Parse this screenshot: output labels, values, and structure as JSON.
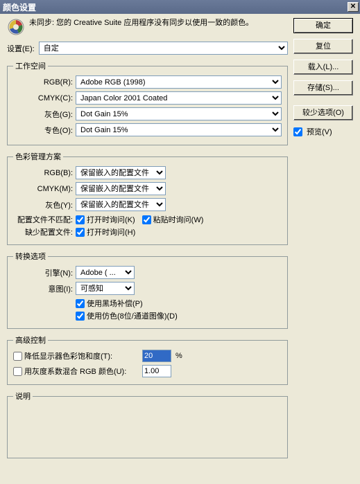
{
  "title": "颜色设置",
  "close_glyph": "✕",
  "sync": {
    "text": "未同步: 您的 Creative Suite 应用程序没有同步以使用一致的颜色。"
  },
  "buttons": {
    "ok": "确定",
    "reset": "复位",
    "load": "载入(L)...",
    "save": "存储(S)...",
    "fewer": "较少选项(O)"
  },
  "preview": {
    "label": "预览(V)"
  },
  "settings": {
    "label": "设置(E):",
    "value": "自定"
  },
  "workspace": {
    "legend": "工作空间",
    "rgb_label": "RGB(R):",
    "rgb_value": "Adobe RGB (1998)",
    "cmyk_label": "CMYK(C):",
    "cmyk_value": "Japan Color 2001 Coated",
    "gray_label": "灰色(G):",
    "gray_value": "Dot Gain 15%",
    "spot_label": "专色(O):",
    "spot_value": "Dot Gain 15%"
  },
  "policy": {
    "legend": "色彩管理方案",
    "rgb_label": "RGB(B):",
    "rgb_value": "保留嵌入的配置文件",
    "cmyk_label": "CMYK(M):",
    "cmyk_value": "保留嵌入的配置文件",
    "gray_label": "灰色(Y):",
    "gray_value": "保留嵌入的配置文件",
    "mismatch_label": "配置文件不匹配:",
    "mismatch_open": "打开时询问(K)",
    "mismatch_paste": "粘贴时询问(W)",
    "missing_label": "缺少配置文件:",
    "missing_open": "打开时询问(H)"
  },
  "conversion": {
    "legend": "转换选项",
    "engine_label": "引擎(N):",
    "engine_value": "Adobe ( ...",
    "intent_label": "意图(I):",
    "intent_value": "可感知",
    "blackpoint": "使用黑场补偿(P)",
    "dither": "使用仿色(8位/通道图像)(D)"
  },
  "advanced": {
    "legend": "高级控制",
    "desat_label": "降低显示器色彩饱和度(T):",
    "desat_value": "20",
    "desat_unit": "%",
    "blend_label": "用灰度系数混合 RGB 颜色(U):",
    "blend_value": "1.00"
  },
  "description": {
    "legend": "说明"
  }
}
